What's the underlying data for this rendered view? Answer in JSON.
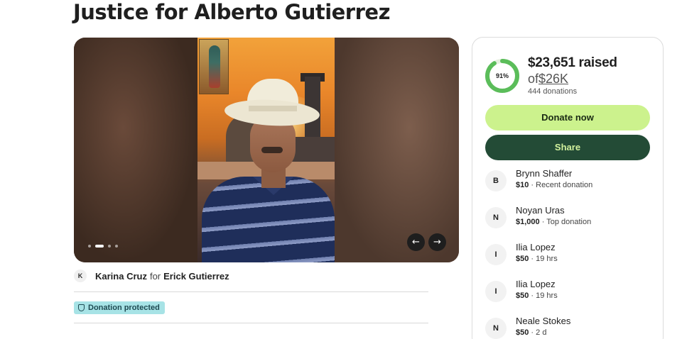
{
  "campaign": {
    "title": "Justice for Alberto Gutierrez"
  },
  "carousel": {
    "slide_count": 4,
    "active_index": 1,
    "prev_label": "←",
    "next_label": "→"
  },
  "organizer": {
    "avatar_initial": "K",
    "name": "Karina Cruz",
    "for_text": "for",
    "beneficiary": "Erick Gutierrez"
  },
  "badge": {
    "label": "Donation protected"
  },
  "progress": {
    "percent_label": "91%",
    "percent_value": 91,
    "raised_text": "$23,651 raised",
    "goal_prefix": "of",
    "goal_amount": "$26K",
    "donations_text": "444 donations",
    "ring_color": "#5bbd5a",
    "ring_track_color": "#e6efe0"
  },
  "actions": {
    "donate_label": "Donate now",
    "share_label": "Share"
  },
  "donors": [
    {
      "initial": "B",
      "name": "Brynn Shaffer",
      "amount": "$10",
      "note": "Recent donation"
    },
    {
      "initial": "N",
      "name": "Noyan Uras",
      "amount": "$1,000",
      "note": "Top donation"
    },
    {
      "initial": "I",
      "name": "Ilia Lopez",
      "amount": "$50",
      "note": "19 hrs"
    },
    {
      "initial": "I",
      "name": "Ilia Lopez",
      "amount": "$50",
      "note": "19 hrs"
    },
    {
      "initial": "N",
      "name": "Neale Stokes",
      "amount": "$50",
      "note": "2 d"
    }
  ],
  "colors": {
    "donate_bg": "#ccf28d",
    "share_bg": "#234b36",
    "badge_bg": "#a7e3e6"
  }
}
